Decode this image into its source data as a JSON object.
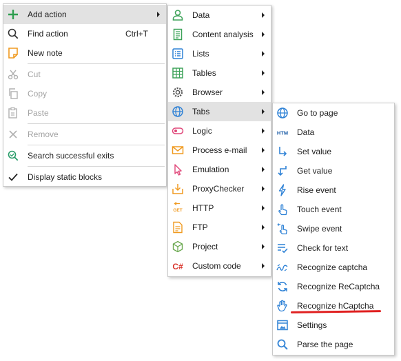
{
  "main_menu": {
    "add_action": "Add action",
    "find_action": "Find action",
    "find_action_shortcut": "Ctrl+T",
    "new_note": "New note",
    "cut": "Cut",
    "copy": "Copy",
    "paste": "Paste",
    "remove": "Remove",
    "search_exits": "Search successful exits",
    "display_static": "Display static blocks"
  },
  "add_action_menu": {
    "data": "Data",
    "content_analysis": "Content analysis",
    "lists": "Lists",
    "tables": "Tables",
    "browser": "Browser",
    "tabs": "Tabs",
    "logic": "Logic",
    "process_email": "Process e-mail",
    "emulation": "Emulation",
    "proxychecker": "ProxyChecker",
    "http": "HTTP",
    "ftp": "FTP",
    "project": "Project",
    "custom_code": "Custom code"
  },
  "tabs_menu": {
    "go_to_page": "Go to page",
    "data": "Data",
    "set_value": "Set value",
    "get_value": "Get value",
    "rise_event": "Rise event",
    "touch_event": "Touch event",
    "swipe_event": "Swipe event",
    "check_text": "Check for text",
    "recognize_captcha": "Recognize captcha",
    "recognize_recaptcha": "Recognize ReCaptcha",
    "recognize_hcaptcha": "Recognize hCaptcha",
    "settings": "Settings",
    "parse_page": "Parse the page"
  },
  "icon_text": {
    "htm": "HTM",
    "get": "GET",
    "csharp": "C#"
  },
  "colors": {
    "highlight": "#e2e2e2",
    "icon_blue": "#2f82d6",
    "icon_green": "#3fa35a",
    "icon_orange": "#f09a20",
    "annotation_red": "#e02020"
  }
}
